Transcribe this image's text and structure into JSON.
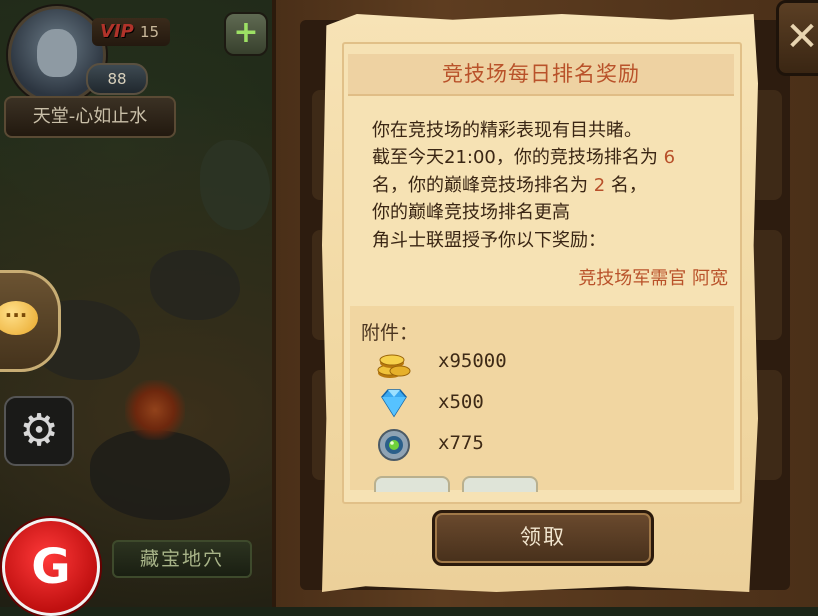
{
  "player": {
    "vip_label": "VIP",
    "vip_level": "15",
    "level": "88",
    "name": "天堂-心如止水"
  },
  "side_buttons": {
    "plus": "+",
    "chat": "···",
    "settings_icon": "gear-icon",
    "logo_glyph": "G"
  },
  "location_label": "藏宝地穴",
  "close_label": "✕",
  "dialog": {
    "title": "竞技场每日排名奖励",
    "line1": "你在竞技场的精彩表现有目共睹。",
    "line2_prefix": "截至今天21:00，你的竞技场排名为 ",
    "arena_rank": "6",
    "line3_prefix": "名，你的巅峰竞技场排名为 ",
    "peak_rank": "2",
    "line3_suffix": " 名，",
    "line4": "你的巅峰竞技场排名更高",
    "line5": "角斗士联盟授予你以下奖励：",
    "signature": "竞技场军需官 阿宽",
    "attachments_label": "附件：",
    "rewards": [
      {
        "icon": "gold-coins-icon",
        "quantity": "x95000",
        "color": "#e8b12a"
      },
      {
        "icon": "diamond-icon",
        "quantity": "x500",
        "color": "#3aa8f0"
      },
      {
        "icon": "orb-icon",
        "quantity": "x775",
        "color": "#6fd23a"
      }
    ],
    "claim_button": "领取"
  }
}
